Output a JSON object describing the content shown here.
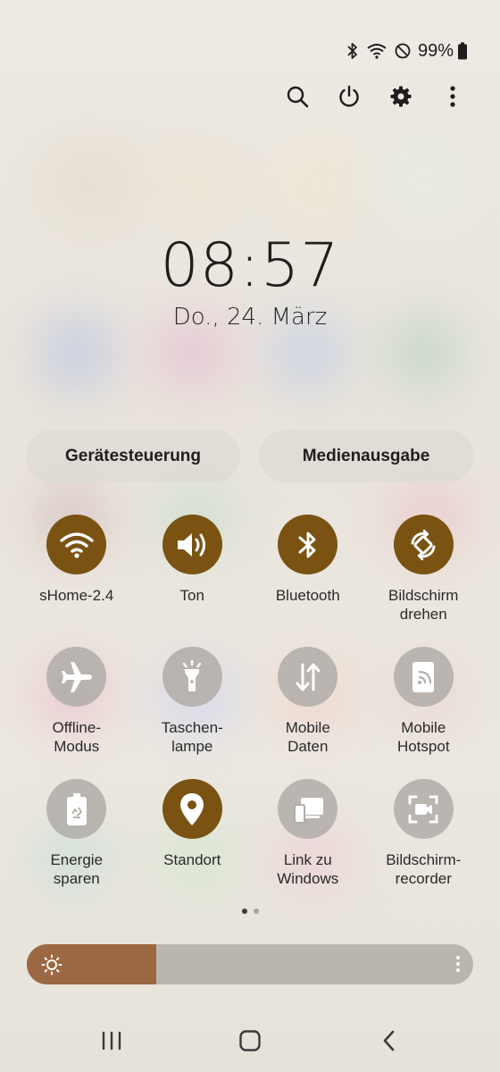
{
  "status_bar": {
    "battery_percent": "99%",
    "icons": [
      "bluetooth-icon",
      "wifi-icon",
      "do-not-disturb-icon",
      "battery-icon"
    ]
  },
  "top_actions": [
    "search-icon",
    "power-icon",
    "settings-gear-icon",
    "more-vertical-icon"
  ],
  "clock": {
    "time": "08:57",
    "date": "Do., 24. März"
  },
  "pills": {
    "device_control": "Gerätesteuerung",
    "media_output": "Medienausgabe"
  },
  "tiles": [
    {
      "label": "sHome-2.4",
      "icon": "wifi-icon",
      "state": "on"
    },
    {
      "label": "Ton",
      "icon": "volume-icon",
      "state": "on"
    },
    {
      "label": "Bluetooth",
      "icon": "bluetooth-icon",
      "state": "on"
    },
    {
      "label": "Bildschirm\ndrehen",
      "icon": "auto-rotate-icon",
      "state": "on"
    },
    {
      "label": "Offline-\nModus",
      "icon": "airplane-icon",
      "state": "off"
    },
    {
      "label": "Taschen-\nlampe",
      "icon": "flashlight-icon",
      "state": "off"
    },
    {
      "label": "Mobile\nDaten",
      "icon": "mobile-data-icon",
      "state": "off"
    },
    {
      "label": "Mobile\nHotspot",
      "icon": "hotspot-icon",
      "state": "off"
    },
    {
      "label": "Energie\nsparen",
      "icon": "power-saving-icon",
      "state": "off"
    },
    {
      "label": "Standort",
      "icon": "location-pin-icon",
      "state": "on"
    },
    {
      "label": "Link zu\nWindows",
      "icon": "link-to-windows-icon",
      "state": "off"
    },
    {
      "label": "Bildschirm-\nrecorder",
      "icon": "screen-recorder-icon",
      "state": "off"
    }
  ],
  "pager": {
    "pages": 2,
    "current": 1
  },
  "brightness": {
    "level_fraction": 0.29
  },
  "colors": {
    "tile_on": "#7a5313",
    "tile_off": "#b2aeaa",
    "brightness_fill": "#9c6844"
  },
  "navbar": [
    "recent-apps-icon",
    "home-icon",
    "back-icon"
  ]
}
